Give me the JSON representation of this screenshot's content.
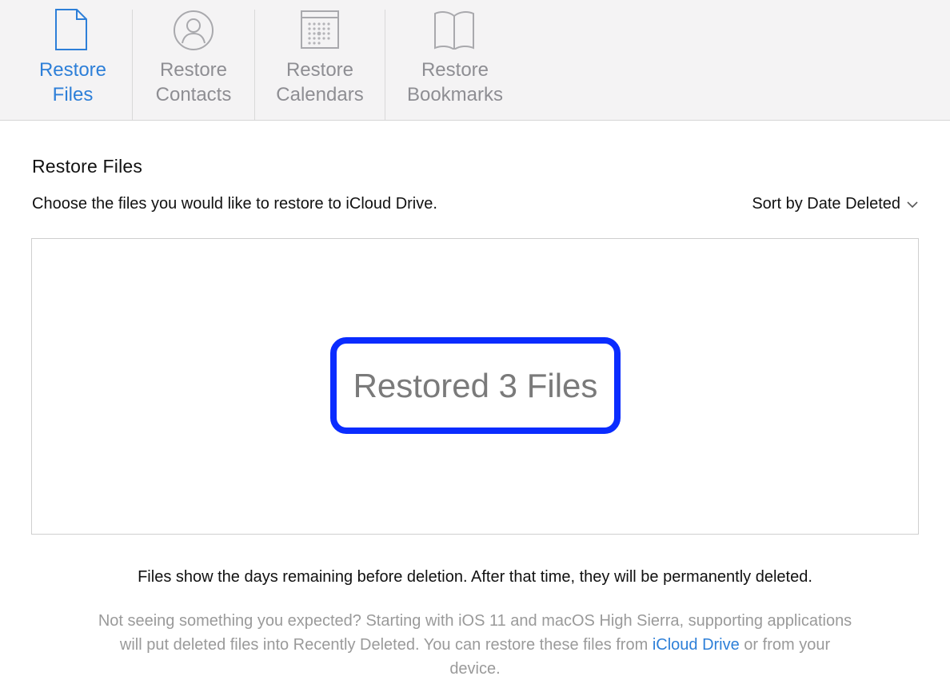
{
  "tabs": [
    {
      "line1": "Restore",
      "line2": "Files",
      "icon": "document-icon",
      "active": true
    },
    {
      "line1": "Restore",
      "line2": "Contacts",
      "icon": "contact-icon",
      "active": false
    },
    {
      "line1": "Restore",
      "line2": "Calendars",
      "icon": "calendar-icon",
      "active": false
    },
    {
      "line1": "Restore",
      "line2": "Bookmarks",
      "icon": "book-icon",
      "active": false
    }
  ],
  "main": {
    "title": "Restore Files",
    "subtitle": "Choose the files you would like to restore to iCloud Drive.",
    "sort_label": "Sort by Date Deleted",
    "restored_message": "Restored 3 Files",
    "info": "Files show the days remaining before deletion. After that time, they will be permanently deleted.",
    "note_text": "Not seeing something you expected? Starting with iOS 11 and macOS High Sierra, supporting applications will put deleted files into Recently Deleted. You can restore these files from ",
    "note_link": "iCloud Drive",
    "note_end": " or from your device."
  },
  "colors": {
    "accent": "#2d7fd8",
    "inactive": "#8e8e93",
    "highlight": "#0a2cff",
    "toolbar_bg": "#f4f3f4"
  }
}
